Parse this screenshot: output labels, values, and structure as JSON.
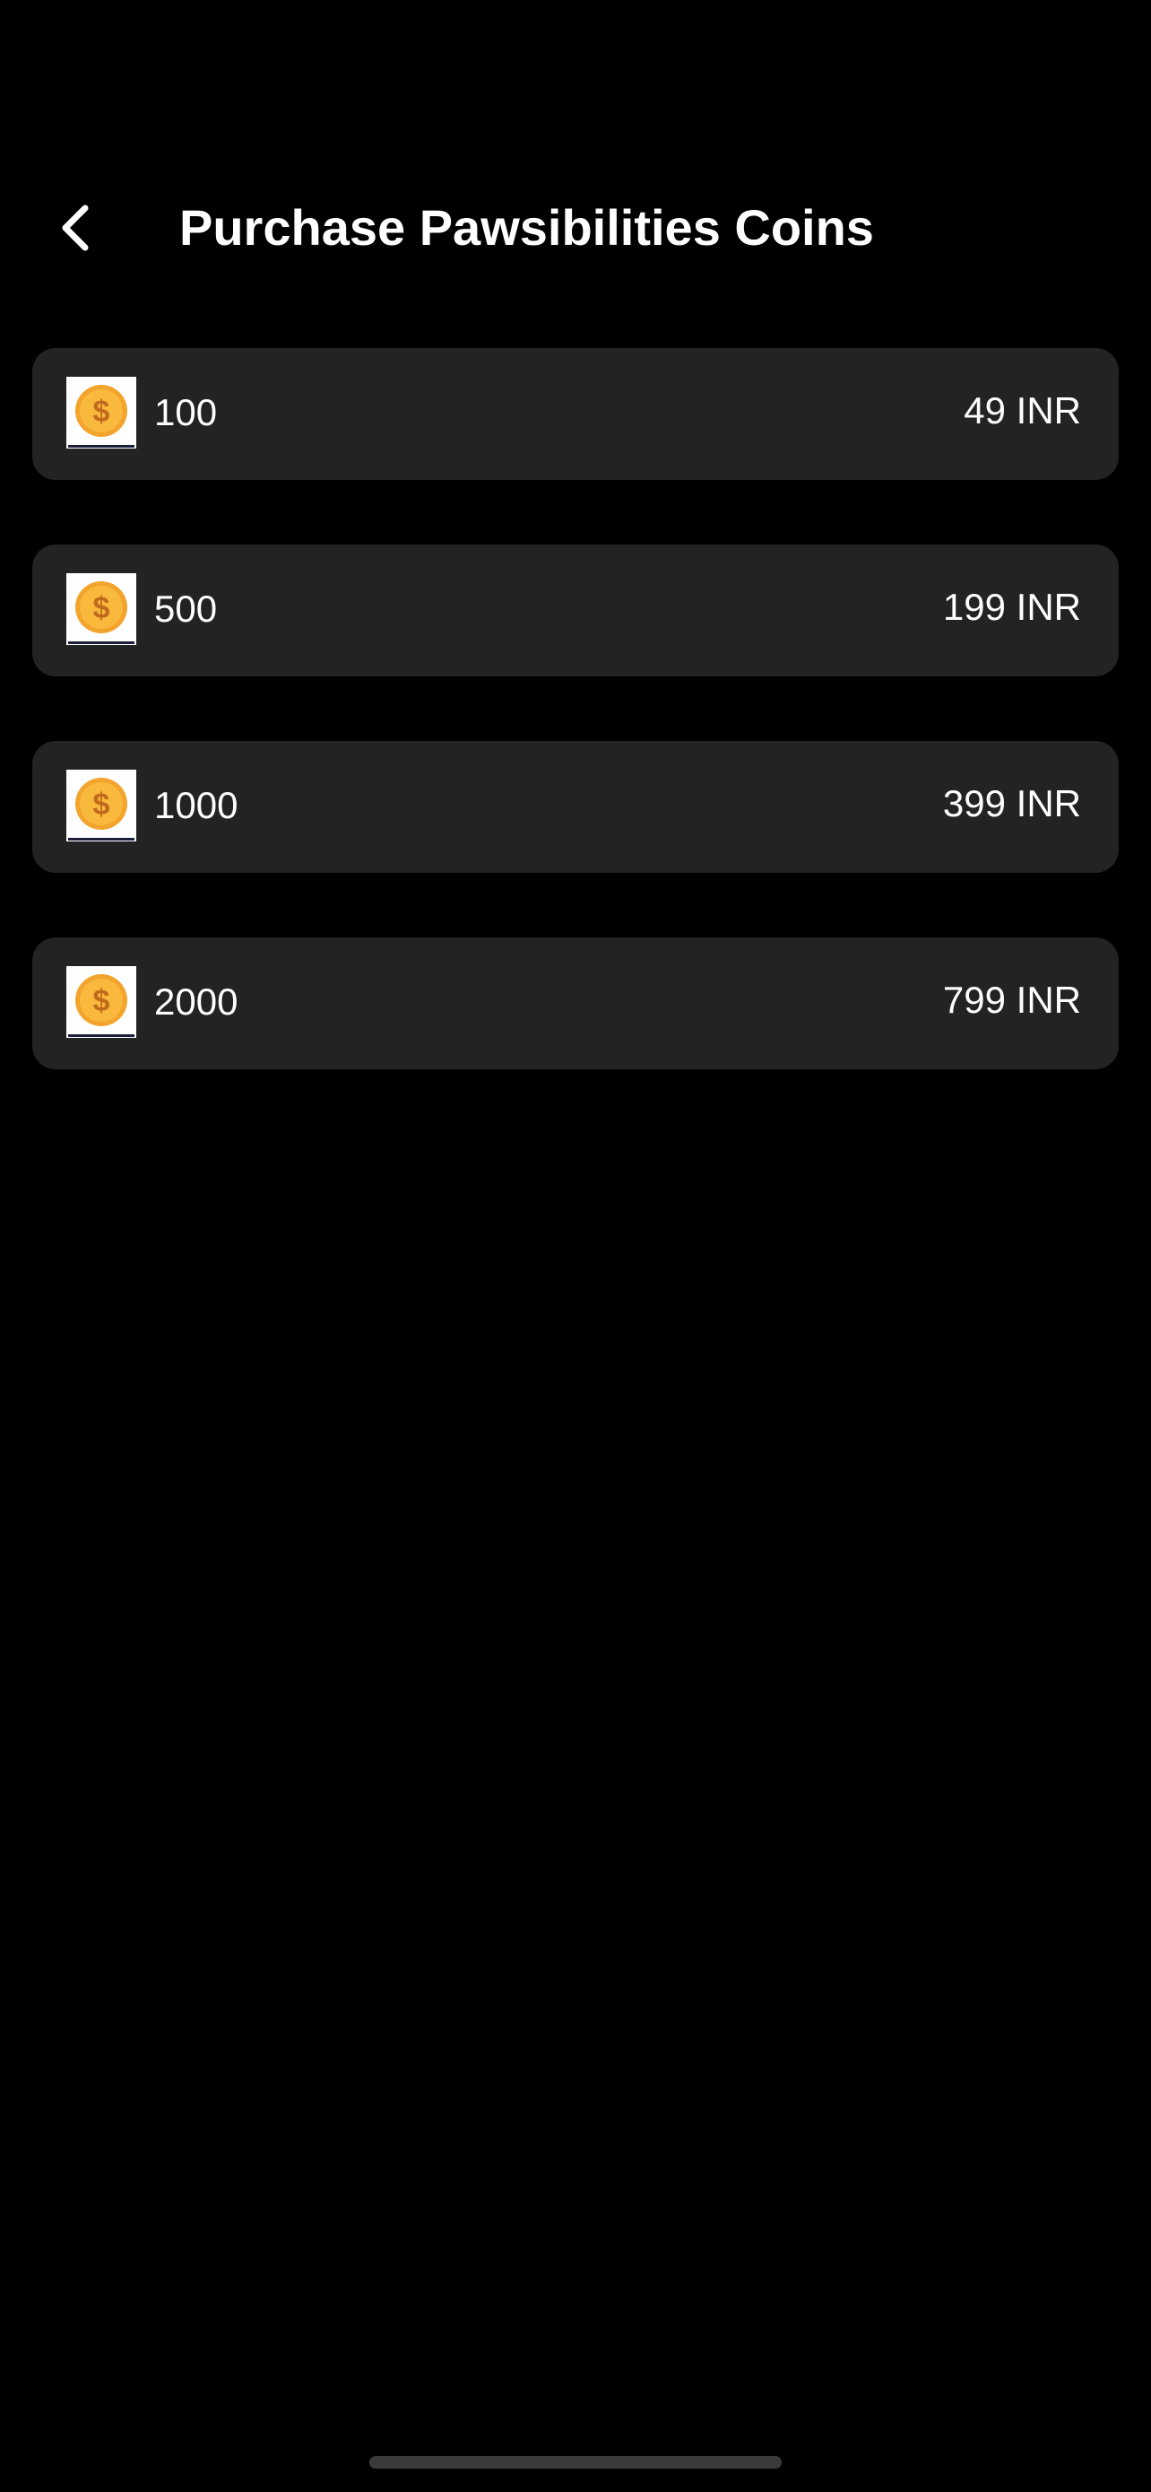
{
  "header": {
    "back_icon": "chevron-left-icon",
    "title": "Purchase Pawsibilities Coins"
  },
  "packages": [
    {
      "coins": "100",
      "price": "49 INR",
      "icon": "coin-dollar-icon"
    },
    {
      "coins": "500",
      "price": "199 INR",
      "icon": "coin-dollar-icon"
    },
    {
      "coins": "1000",
      "price": "399 INR",
      "icon": "coin-dollar-icon"
    },
    {
      "coins": "2000",
      "price": "799 INR",
      "icon": "coin-dollar-icon"
    }
  ],
  "colors": {
    "background": "#000000",
    "card": "#232323",
    "text": "#ffffff",
    "coin_fill": "#f9b93c",
    "coin_symbol": "#c06a1e",
    "home_indicator": "#3a3a3a"
  }
}
